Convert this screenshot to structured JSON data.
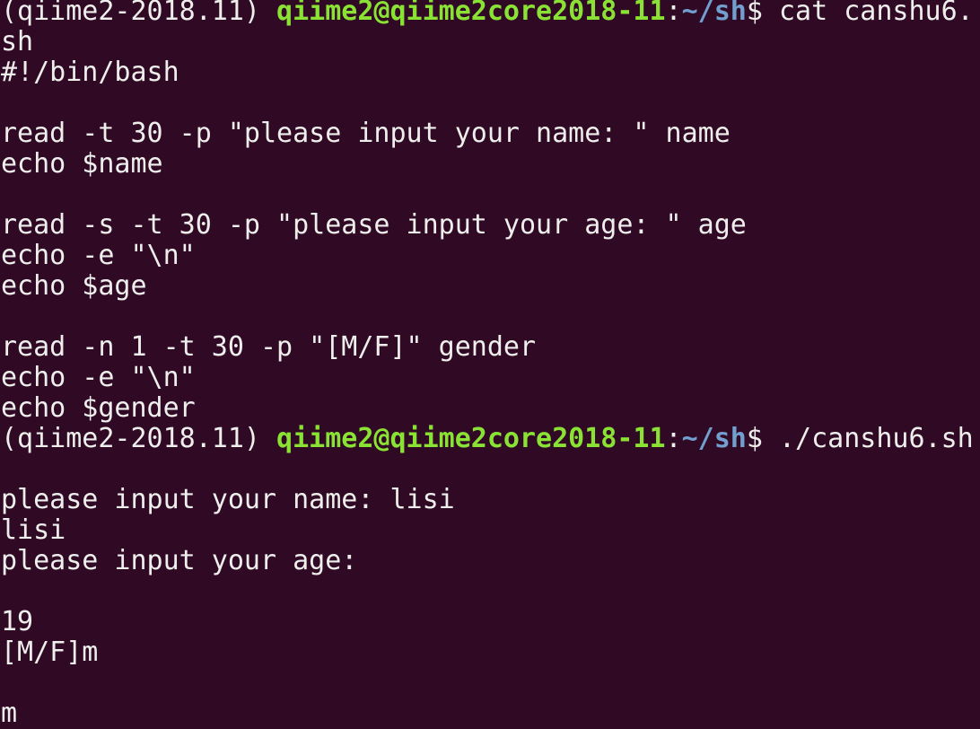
{
  "colors": {
    "background": "#300a24",
    "text": "#eeeeec",
    "prompt_user": "#8ae234",
    "prompt_path": "#729fcf"
  },
  "lines": [
    {
      "kind": "prompt",
      "segments": [
        {
          "text": "(qiime2-2018.11) ",
          "style": "plain"
        },
        {
          "text": "qiime2@qiime2core2018-11",
          "style": "user"
        },
        {
          "text": ":",
          "style": "plain"
        },
        {
          "text": "~/sh",
          "style": "path"
        },
        {
          "text": "$ cat canshu6.",
          "style": "plain"
        }
      ]
    },
    {
      "kind": "output",
      "segments": [
        {
          "text": "sh",
          "style": "plain"
        }
      ]
    },
    {
      "kind": "output",
      "segments": [
        {
          "text": "#!/bin/bash",
          "style": "plain"
        }
      ]
    },
    {
      "kind": "output",
      "segments": [
        {
          "text": "",
          "style": "plain"
        }
      ]
    },
    {
      "kind": "output",
      "segments": [
        {
          "text": "read -t 30 -p \"please input your name: \" name",
          "style": "plain"
        }
      ]
    },
    {
      "kind": "output",
      "segments": [
        {
          "text": "echo $name",
          "style": "plain"
        }
      ]
    },
    {
      "kind": "output",
      "segments": [
        {
          "text": "",
          "style": "plain"
        }
      ]
    },
    {
      "kind": "output",
      "segments": [
        {
          "text": "read -s -t 30 -p \"please input your age: \" age",
          "style": "plain"
        }
      ]
    },
    {
      "kind": "output",
      "segments": [
        {
          "text": "echo -e \"\\n\"",
          "style": "plain"
        }
      ]
    },
    {
      "kind": "output",
      "segments": [
        {
          "text": "echo $age",
          "style": "plain"
        }
      ]
    },
    {
      "kind": "output",
      "segments": [
        {
          "text": "",
          "style": "plain"
        }
      ]
    },
    {
      "kind": "output",
      "segments": [
        {
          "text": "read -n 1 -t 30 -p \"[M/F]\" gender",
          "style": "plain"
        }
      ]
    },
    {
      "kind": "output",
      "segments": [
        {
          "text": "echo -e \"\\n\"",
          "style": "plain"
        }
      ]
    },
    {
      "kind": "output",
      "segments": [
        {
          "text": "echo $gender",
          "style": "plain"
        }
      ]
    },
    {
      "kind": "prompt",
      "segments": [
        {
          "text": "(qiime2-2018.11) ",
          "style": "plain"
        },
        {
          "text": "qiime2@qiime2core2018-11",
          "style": "user"
        },
        {
          "text": ":",
          "style": "plain"
        },
        {
          "text": "~/sh",
          "style": "path"
        },
        {
          "text": "$ ./canshu6.sh",
          "style": "plain"
        }
      ]
    },
    {
      "kind": "output",
      "segments": [
        {
          "text": "",
          "style": "plain"
        }
      ]
    },
    {
      "kind": "output",
      "segments": [
        {
          "text": "please input your name: lisi",
          "style": "plain"
        }
      ]
    },
    {
      "kind": "output",
      "segments": [
        {
          "text": "lisi",
          "style": "plain"
        }
      ]
    },
    {
      "kind": "output",
      "segments": [
        {
          "text": "please input your age:",
          "style": "plain"
        }
      ]
    },
    {
      "kind": "output",
      "segments": [
        {
          "text": "",
          "style": "plain"
        }
      ]
    },
    {
      "kind": "output",
      "segments": [
        {
          "text": "19",
          "style": "plain"
        }
      ]
    },
    {
      "kind": "output",
      "segments": [
        {
          "text": "[M/F]m",
          "style": "plain"
        }
      ]
    },
    {
      "kind": "output",
      "segments": [
        {
          "text": "",
          "style": "plain"
        }
      ]
    },
    {
      "kind": "output",
      "segments": [
        {
          "text": "m",
          "style": "plain"
        }
      ]
    }
  ]
}
